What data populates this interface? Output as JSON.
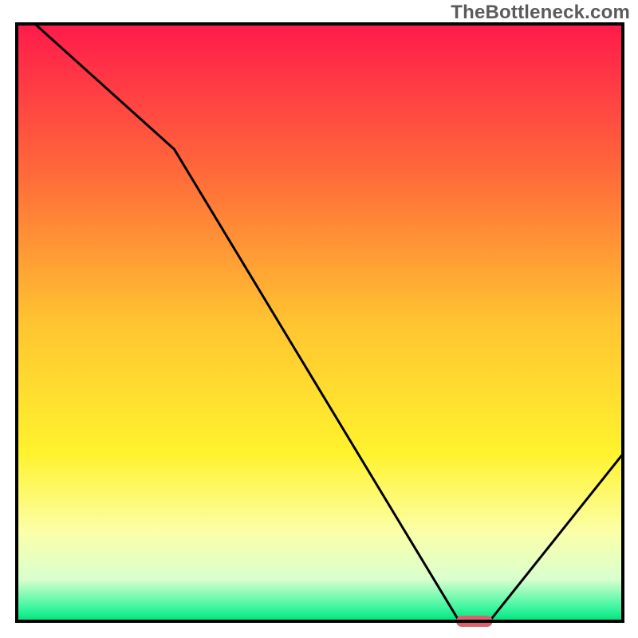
{
  "watermark": "TheBottleneck.com",
  "chart_data": {
    "type": "line",
    "title": "",
    "xlabel": "",
    "ylabel": "",
    "xlim": [
      0,
      100
    ],
    "ylim": [
      0,
      100
    ],
    "x": [
      3,
      26,
      73,
      78,
      100
    ],
    "values": [
      100,
      79,
      0,
      0,
      28
    ],
    "marker": {
      "x": 75.5,
      "y": 0,
      "width": 6,
      "color": "#d9626c"
    },
    "gradient_stops": [
      {
        "offset": 0,
        "color": "#ff1a4b"
      },
      {
        "offset": 25,
        "color": "#ff6a3a"
      },
      {
        "offset": 50,
        "color": "#ffc431"
      },
      {
        "offset": 72,
        "color": "#fff32e"
      },
      {
        "offset": 85,
        "color": "#fcffa8"
      },
      {
        "offset": 93,
        "color": "#d9ffce"
      },
      {
        "offset": 98,
        "color": "#34f59c"
      },
      {
        "offset": 100,
        "color": "#00e07a"
      }
    ],
    "frame_color": "#000000",
    "line_color": "#000000"
  }
}
